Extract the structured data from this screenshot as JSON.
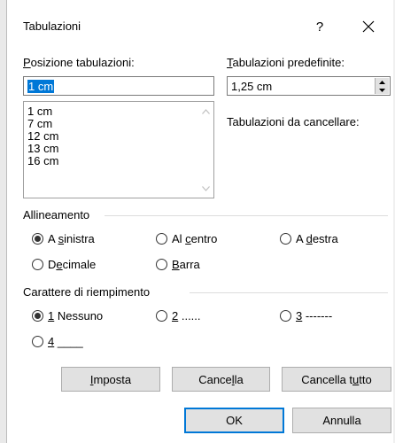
{
  "window": {
    "title": "Tabulazioni",
    "help_label": "?",
    "close_icon": "close-icon"
  },
  "tab_positions": {
    "label_u": "P",
    "label_rest": "osizione tabulazioni:",
    "input_value": "1 cm",
    "list": [
      "1 cm",
      "7 cm",
      "12 cm",
      "13 cm",
      "16 cm"
    ]
  },
  "default_tabs": {
    "label_u": "T",
    "label_rest": "abulazioni predefinite:",
    "value": "1,25 cm"
  },
  "to_clear": {
    "label": "Tabulazioni da cancellare:"
  },
  "alignment": {
    "group_label": "Allineamento",
    "options": [
      {
        "pre": "A ",
        "u": "s",
        "post": "inistra",
        "checked": true
      },
      {
        "pre": "Al ",
        "u": "c",
        "post": "entro",
        "checked": false
      },
      {
        "pre": "A ",
        "u": "d",
        "post": "estra",
        "checked": false
      },
      {
        "pre": "D",
        "u": "e",
        "post": "cimale",
        "checked": false
      },
      {
        "pre": "",
        "u": "B",
        "post": "arra",
        "checked": false
      }
    ]
  },
  "leader": {
    "group_label": "Carattere di riempimento",
    "options": [
      {
        "pre": "",
        "u": "1",
        "post": " Nessuno",
        "checked": true
      },
      {
        "pre": "",
        "u": "2",
        "post": " ......",
        "checked": false
      },
      {
        "pre": "",
        "u": "3",
        "post": " -------",
        "checked": false
      },
      {
        "pre": "",
        "u": "4",
        "post": " ____",
        "checked": false
      }
    ]
  },
  "buttons": {
    "set": {
      "pre": "",
      "u": "I",
      "post": "mposta"
    },
    "clear": {
      "pre": "Cance",
      "u": "l",
      "post": "la"
    },
    "clear_all": {
      "pre": "Cancella t",
      "u": "u",
      "post": "tto"
    },
    "ok": "OK",
    "cancel": "Annulla"
  },
  "colors": {
    "accent": "#0078d7",
    "button_bg": "#e1e1e1"
  }
}
